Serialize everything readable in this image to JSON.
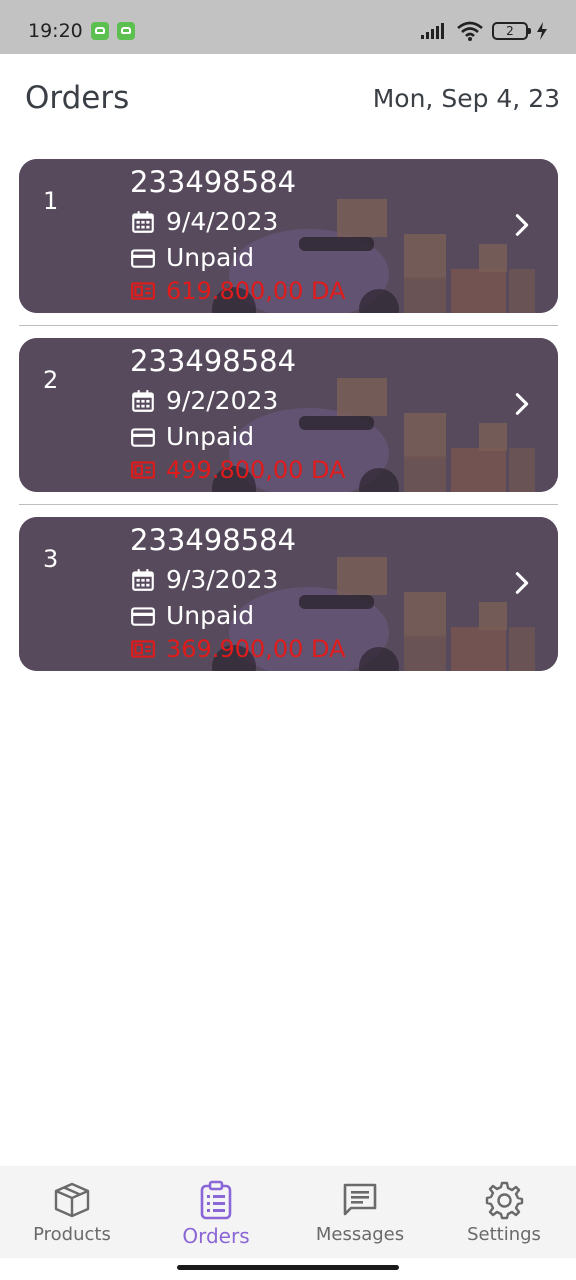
{
  "status_bar": {
    "time": "19:20",
    "battery_level": "2"
  },
  "header": {
    "title": "Orders",
    "date": "Mon, Sep 4, 23"
  },
  "orders": [
    {
      "index": "1",
      "number": "233498584",
      "date": "9/4/2023",
      "payment_status": "Unpaid",
      "total": "619.800,00 DA"
    },
    {
      "index": "2",
      "number": "233498584",
      "date": "9/2/2023",
      "payment_status": "Unpaid",
      "total": "499.800,00 DA"
    },
    {
      "index": "3",
      "number": "233498584",
      "date": "9/3/2023",
      "payment_status": "Unpaid",
      "total": "369.900,00 DA"
    }
  ],
  "bottom_nav": {
    "items": [
      {
        "label": "Products",
        "icon": "package-icon"
      },
      {
        "label": "Orders",
        "icon": "clipboard-list-icon",
        "active": true
      },
      {
        "label": "Messages",
        "icon": "message-icon"
      },
      {
        "label": "Settings",
        "icon": "gear-icon"
      }
    ]
  },
  "colors": {
    "accent": "#8a66d6",
    "card_background": "#574a5c",
    "total_text": "#e01b1b",
    "status_bar": "#c2c2c2"
  }
}
